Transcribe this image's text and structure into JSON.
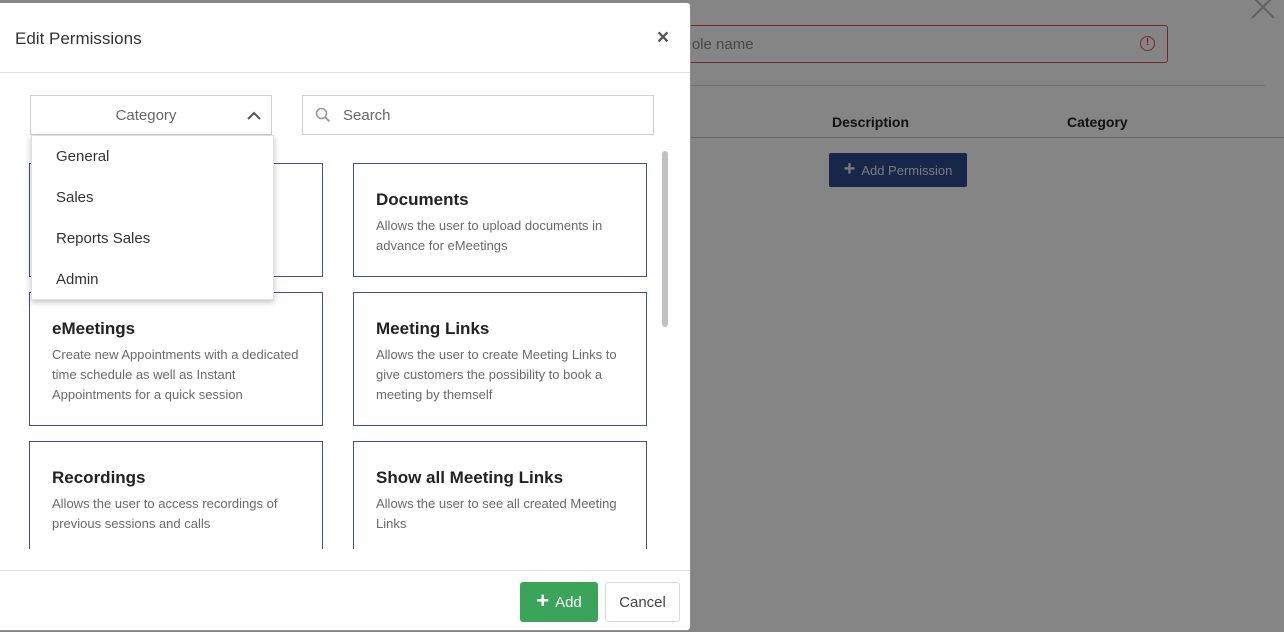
{
  "background": {
    "role_name_placeholder": "Role name",
    "columns": [
      "Description",
      "Category"
    ],
    "add_permission_label": "Add Permission"
  },
  "modal": {
    "title": "Edit Permissions",
    "category_select_label": "Category",
    "search_placeholder": "Search",
    "category_options": [
      "General",
      "Sales",
      "Reports Sales",
      "Admin"
    ],
    "cards": [
      {
        "title": "Documents",
        "description": "Allows the user to upload documents in advance for eMeetings"
      },
      {
        "title": "eMeetings",
        "description": "Create new Appointments with a dedicated time schedule as well as Instant Appointments for a quick session"
      },
      {
        "title": "Meeting Links",
        "description": "Allows the user to create Meeting Links to give customers the possibility to book a meeting by themself"
      },
      {
        "title": "Recordings",
        "description": "Allows the user to access recordings of previous sessions and calls"
      },
      {
        "title": "Show all Meeting Links",
        "description": "Allows the user to see all created Meeting Links"
      }
    ],
    "add_label": "Add",
    "cancel_label": "Cancel"
  },
  "colors": {
    "card_border": "#3b4f9a",
    "add_button": "#3aa55a",
    "add_permission_button": "#2c4a8c",
    "error": "#e5484d"
  },
  "icons": [
    "close-icon",
    "chevron-up-icon",
    "search-icon",
    "plus-icon",
    "warning-icon"
  ]
}
